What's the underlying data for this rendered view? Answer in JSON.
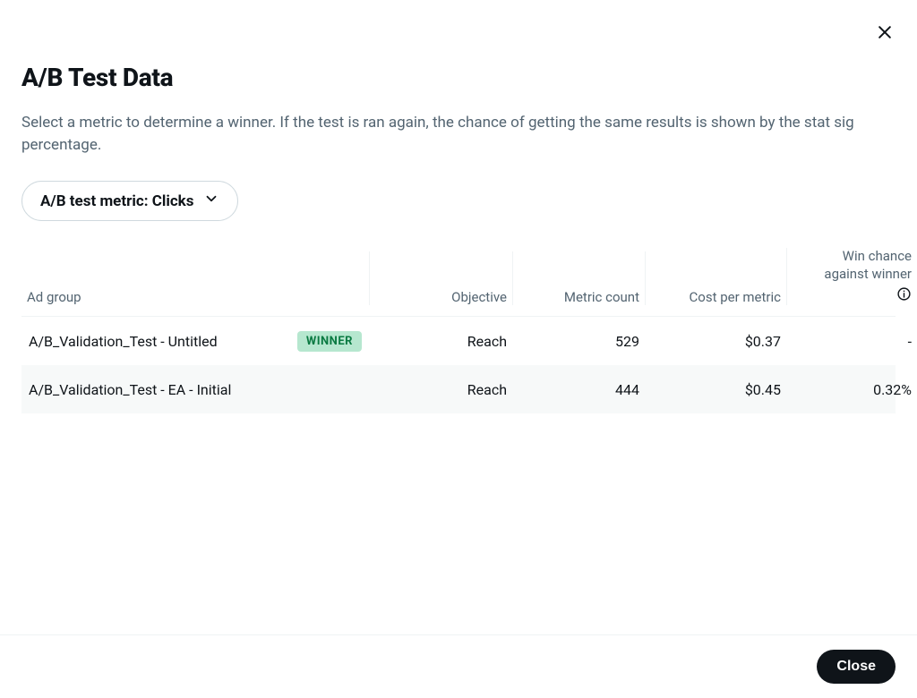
{
  "header": {
    "title": "A/B Test Data",
    "description": "Select a metric to determine a winner. If the test is ran again, the chance of getting the same results is shown by the stat sig percentage."
  },
  "metric_selector": {
    "label": "A/B test metric: Clicks"
  },
  "table": {
    "columns": {
      "ad_group": "Ad group",
      "objective": "Objective",
      "metric_count": "Metric count",
      "cost_per_metric": "Cost per metric",
      "win_chance_line1": "Win chance",
      "win_chance_line2": "against winner"
    },
    "rows": [
      {
        "ad_group": "A/B_Validation_Test - Untitled",
        "is_winner": true,
        "winner_label": "WINNER",
        "objective": "Reach",
        "metric_count": "529",
        "cost_per_metric": "$0.37",
        "win_chance": "-"
      },
      {
        "ad_group": "A/B_Validation_Test - EA - Initial",
        "is_winner": false,
        "winner_label": "",
        "objective": "Reach",
        "metric_count": "444",
        "cost_per_metric": "$0.45",
        "win_chance": "0.32%"
      }
    ]
  },
  "footer": {
    "close_label": "Close"
  }
}
